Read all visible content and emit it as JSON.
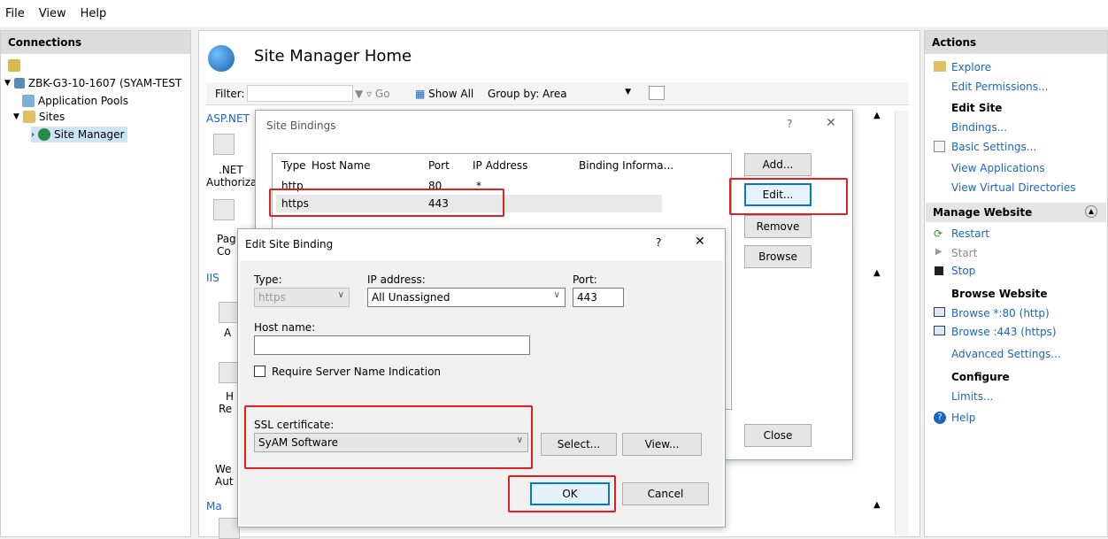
{
  "menubar": {
    "file": "File",
    "view": "View",
    "help": "Help"
  },
  "connections": {
    "title": "Connections",
    "server": "ZBK-G3-10-1607 (SYAM-TEST",
    "app_pools": "Application Pools",
    "sites": "Sites",
    "site_manager": "Site Manager"
  },
  "main": {
    "title": "Site Manager Home",
    "filter_label": "Filter:",
    "go": "Go",
    "show_all": "Show All",
    "group_by_label": "Group by:",
    "group_by_value": "Area",
    "section_aspnet": "ASP.NET",
    "section_iis": "IIS",
    "section_mgmt": "Ma",
    "net_auth_line1": ".NET",
    "net_auth_line2": "Authoriza",
    "page_line1": "Pag",
    "page_line2": "Co",
    "a_label": "A",
    "h_line1": "H",
    "h_line2": "Re",
    "we_line1": "We",
    "we_line2": "Aut"
  },
  "site_bindings": {
    "title": "Site Bindings",
    "help_glyph": "?",
    "close_glyph": "✕",
    "columns": [
      "Type",
      "Host Name",
      "Port",
      "IP Address",
      "Binding Informa..."
    ],
    "rows": [
      {
        "type": "http",
        "host": "",
        "port": "80",
        "ip": "*",
        "info": ""
      },
      {
        "type": "https",
        "host": "",
        "port": "443",
        "ip": "",
        "info": ""
      }
    ],
    "add": "Add...",
    "edit": "Edit...",
    "remove": "Remove",
    "browse": "Browse",
    "close": "Close"
  },
  "edit_binding": {
    "title": "Edit Site Binding",
    "help_glyph": "?",
    "close_glyph": "✕",
    "type_label": "Type:",
    "type_value": "https",
    "ip_label": "IP address:",
    "ip_value": "All Unassigned",
    "port_label": "Port:",
    "port_value": "443",
    "host_label": "Host name:",
    "host_value": "",
    "sni_label": "Require Server Name Indication",
    "ssl_label": "SSL certificate:",
    "ssl_value": "SyAM Software",
    "select": "Select...",
    "view": "View...",
    "ok": "OK",
    "cancel": "Cancel"
  },
  "actions": {
    "title": "Actions",
    "explore": "Explore",
    "edit_permissions": "Edit Permissions...",
    "edit_site": "Edit Site",
    "bindings": "Bindings...",
    "basic_settings": "Basic Settings...",
    "view_applications": "View Applications",
    "view_virtual_dirs": "View Virtual Directories",
    "manage_website": "Manage Website",
    "restart": "Restart",
    "start": "Start",
    "stop": "Stop",
    "browse_website": "Browse Website",
    "browse_80": "Browse *:80 (http)",
    "browse_443": "Browse :443 (https)",
    "advanced_settings": "Advanced Settings...",
    "configure": "Configure",
    "limits": "Limits...",
    "help": "Help"
  },
  "colors": {
    "accent": "#1a64c6",
    "highlight": "#e02020",
    "header_gray": "#dcdcdc"
  }
}
